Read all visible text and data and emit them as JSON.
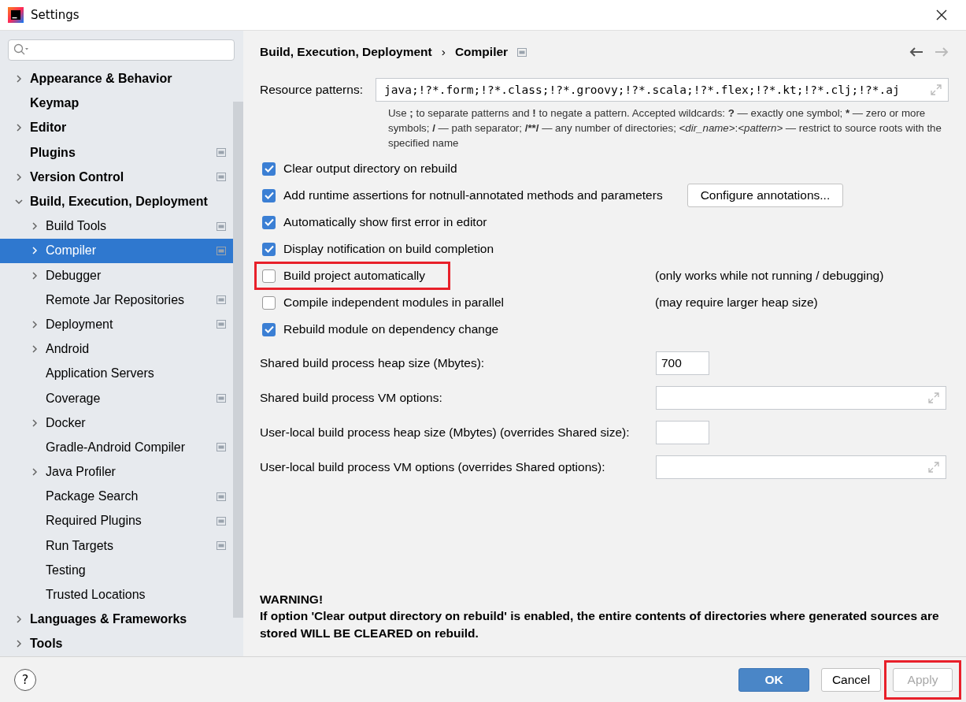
{
  "window": {
    "title": "Settings"
  },
  "sidebar": {
    "items": [
      {
        "label": "Appearance & Behavior",
        "kind": "collapsed",
        "selected": false,
        "project_scope": false
      },
      {
        "label": "Keymap",
        "kind": "leaf",
        "selected": false,
        "project_scope": false
      },
      {
        "label": "Editor",
        "kind": "collapsed",
        "selected": false,
        "project_scope": false
      },
      {
        "label": "Plugins",
        "kind": "leaf",
        "selected": false,
        "project_scope": true
      },
      {
        "label": "Version Control",
        "kind": "collapsed",
        "selected": false,
        "project_scope": true
      },
      {
        "label": "Build, Execution, Deployment",
        "kind": "expanded",
        "selected": false,
        "project_scope": false,
        "children": [
          {
            "label": "Build Tools",
            "kind": "collapsed",
            "selected": false,
            "project_scope": true
          },
          {
            "label": "Compiler",
            "kind": "collapsed",
            "selected": true,
            "project_scope": true
          },
          {
            "label": "Debugger",
            "kind": "collapsed",
            "selected": false,
            "project_scope": false
          },
          {
            "label": "Remote Jar Repositories",
            "kind": "leaf",
            "selected": false,
            "project_scope": true
          },
          {
            "label": "Deployment",
            "kind": "collapsed",
            "selected": false,
            "project_scope": true
          },
          {
            "label": "Android",
            "kind": "collapsed",
            "selected": false,
            "project_scope": false
          },
          {
            "label": "Application Servers",
            "kind": "leaf",
            "selected": false,
            "project_scope": false
          },
          {
            "label": "Coverage",
            "kind": "leaf",
            "selected": false,
            "project_scope": true
          },
          {
            "label": "Docker",
            "kind": "collapsed",
            "selected": false,
            "project_scope": false
          },
          {
            "label": "Gradle-Android Compiler",
            "kind": "leaf",
            "selected": false,
            "project_scope": true
          },
          {
            "label": "Java Profiler",
            "kind": "collapsed",
            "selected": false,
            "project_scope": false
          },
          {
            "label": "Package Search",
            "kind": "leaf",
            "selected": false,
            "project_scope": true
          },
          {
            "label": "Required Plugins",
            "kind": "leaf",
            "selected": false,
            "project_scope": true
          },
          {
            "label": "Run Targets",
            "kind": "leaf",
            "selected": false,
            "project_scope": true
          },
          {
            "label": "Testing",
            "kind": "leaf",
            "selected": false,
            "project_scope": false
          },
          {
            "label": "Trusted Locations",
            "kind": "leaf",
            "selected": false,
            "project_scope": false
          }
        ]
      },
      {
        "label": "Languages & Frameworks",
        "kind": "collapsed",
        "selected": false,
        "project_scope": false
      },
      {
        "label": "Tools",
        "kind": "collapsed",
        "selected": false,
        "project_scope": false
      }
    ]
  },
  "breadcrumb": {
    "items": [
      "Build, Execution, Deployment",
      "Compiler"
    ],
    "separator": "›"
  },
  "resource_patterns": {
    "label": "Resource patterns:",
    "value": "java;!?*.form;!?*.class;!?*.groovy;!?*.scala;!?*.flex;!?*.kt;!?*.clj;!?*.aj",
    "hint": [
      {
        "text": "Use ",
        "kind": "plain"
      },
      {
        "text": ";",
        "kind": "bold"
      },
      {
        "text": " to separate patterns and ",
        "kind": "plain"
      },
      {
        "text": "!",
        "kind": "bold"
      },
      {
        "text": " to negate a pattern. Accepted wildcards: ",
        "kind": "plain"
      },
      {
        "text": "?",
        "kind": "bold"
      },
      {
        "text": " — exactly one symbol; ",
        "kind": "plain"
      },
      {
        "text": "*",
        "kind": "bold"
      },
      {
        "text": " — zero or more symbols; ",
        "kind": "plain"
      },
      {
        "text": "/",
        "kind": "bold"
      },
      {
        "text": " — path separator; ",
        "kind": "plain"
      },
      {
        "text": "/**/",
        "kind": "bold"
      },
      {
        "text": " — any number of directories; ",
        "kind": "plain"
      },
      {
        "text": "<dir_name>",
        "kind": "italic"
      },
      {
        "text": ":",
        "kind": "plain"
      },
      {
        "text": "<pattern>",
        "kind": "italic"
      },
      {
        "text": " — restrict to source roots with the specified name",
        "kind": "plain"
      }
    ]
  },
  "options": [
    {
      "label": "Clear output directory on rebuild",
      "checked": true,
      "highlighted": false
    },
    {
      "label": "Add runtime assertions for notnull-annotated methods and parameters",
      "checked": true,
      "highlighted": false,
      "button": "Configure annotations..."
    },
    {
      "label": "Automatically show first error in editor",
      "checked": true,
      "highlighted": false
    },
    {
      "label": "Display notification on build completion",
      "checked": true,
      "highlighted": false
    },
    {
      "label": "Build project automatically",
      "checked": false,
      "highlighted": true,
      "note": "(only works while not running / debugging)"
    },
    {
      "label": "Compile independent modules in parallel",
      "checked": false,
      "highlighted": false,
      "note": "(may require larger heap size)"
    },
    {
      "label": "Rebuild module on dependency change",
      "checked": true,
      "highlighted": false
    }
  ],
  "fields": [
    {
      "label": "Shared build process heap size (Mbytes):",
      "kind": "short",
      "value": "700"
    },
    {
      "label": "Shared build process VM options:",
      "kind": "expandable"
    },
    {
      "label": "User-local build process heap size (Mbytes) (overrides Shared size):",
      "kind": "short"
    },
    {
      "label": "User-local build process VM options (overrides Shared options):",
      "kind": "expandable"
    }
  ],
  "warning": {
    "title": "WARNING!",
    "text": "If option 'Clear output directory on rebuild' is enabled, the entire contents of directories where generated sources are stored WILL BE CLEARED on rebuild."
  },
  "footer": {
    "help": "?",
    "buttons": [
      {
        "label": "OK",
        "kind": "primary",
        "disabled": false,
        "highlighted": false
      },
      {
        "label": "Cancel",
        "kind": "normal",
        "disabled": false,
        "highlighted": false
      },
      {
        "label": "Apply",
        "kind": "normal",
        "disabled": true,
        "highlighted": true
      }
    ]
  }
}
